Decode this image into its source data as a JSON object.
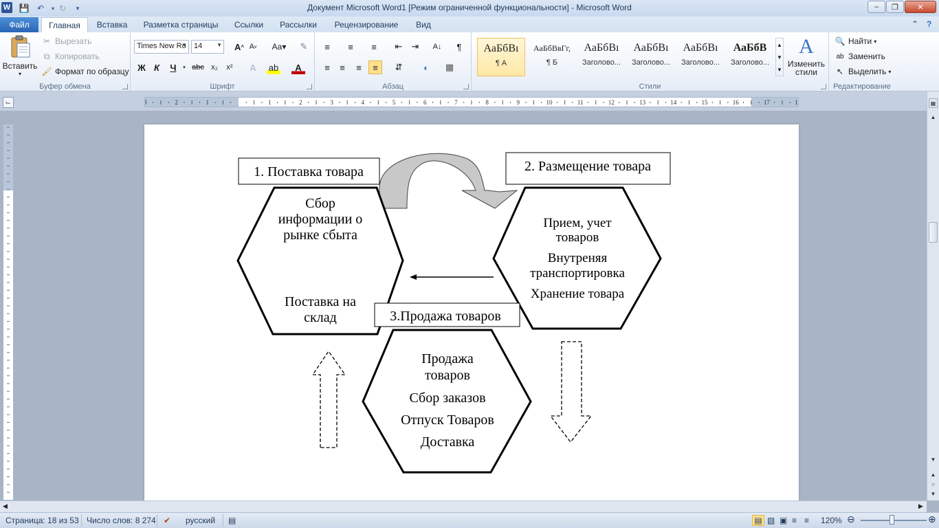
{
  "window": {
    "title": "Документ Microsoft Word1 [Режим ограниченной функциональности]  -  Microsoft Word",
    "app_icon": "W"
  },
  "tabs": {
    "file": "Файл",
    "items": [
      "Главная",
      "Вставка",
      "Разметка страницы",
      "Ссылки",
      "Рассылки",
      "Рецензирование",
      "Вид"
    ],
    "active": "Главная"
  },
  "clipboard": {
    "paste": "Вставить",
    "cut": "Вырезать",
    "copy": "Копировать",
    "format_painter": "Формат по образцу",
    "label": "Буфер обмена"
  },
  "font": {
    "name": "Times New Ro",
    "size": "14",
    "label": "Шрифт",
    "bold": "Ж",
    "italic": "К",
    "underline": "Ч",
    "strike": "abc"
  },
  "paragraph": {
    "label": "Абзац"
  },
  "styles": {
    "label": "Стили",
    "items": [
      {
        "sample": "АаБбВı",
        "name": "¶ А"
      },
      {
        "sample": "АаБбВвГг,",
        "name": "¶ Б"
      },
      {
        "sample": "АаБбВı",
        "name": "Заголово..."
      },
      {
        "sample": "АаБбВı",
        "name": "Заголово..."
      },
      {
        "sample": "АаБбВı",
        "name": "Заголово..."
      },
      {
        "sample": "АаБбВ",
        "name": "Заголово..."
      }
    ],
    "change_styles": "Изменить стили"
  },
  "editing": {
    "label": "Редактирование",
    "find": "Найти",
    "replace": "Заменить",
    "select": "Выделить"
  },
  "diagram": {
    "box1": "1. Поставка товара",
    "box2": "2. Размещение товара",
    "box3": "3.Продажа товаров",
    "hex1_lines": [
      "Сбор",
      "информации о",
      "рынке сбыта",
      "Поставка на",
      "склад"
    ],
    "hex2_lines": [
      "Прием, учет",
      "товаров",
      "Внутреняя",
      "транспортировка",
      "Хранение  товара"
    ],
    "hex3_lines": [
      "Продажа",
      "товаров",
      "Сбор заказов",
      "Отпуск Товаров",
      "Доставка"
    ]
  },
  "status": {
    "page": "Страница: 18 из 53",
    "words": "Число слов: 8 274",
    "language": "русский",
    "zoom": "120%"
  }
}
